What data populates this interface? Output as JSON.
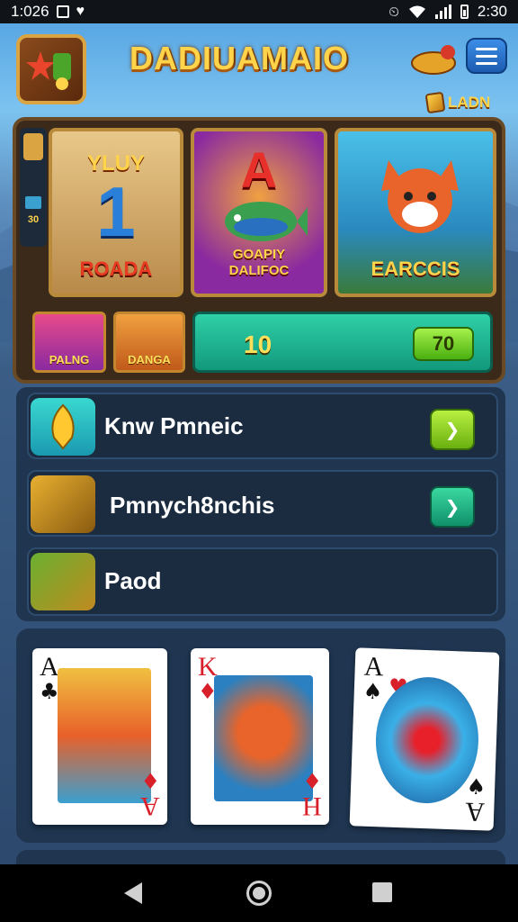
{
  "status_bar": {
    "time_left": "1:026",
    "time_right": "2:30"
  },
  "header": {
    "title": "DADIUAMAIO",
    "language_label": "LADN"
  },
  "side_strip": {
    "value": "30"
  },
  "slots": [
    {
      "top_text": "YLUY",
      "big_letter": "1",
      "bottom_text": "ROADA"
    },
    {
      "big_letter": "A",
      "bottom_text": "GOAPIY\nDALIFOC"
    },
    {
      "bottom_text": "EARCCIS"
    }
  ],
  "mini_games": [
    {
      "label": "PALNG"
    },
    {
      "label": "DANGA"
    }
  ],
  "bet": {
    "value": "10",
    "button_label": "70"
  },
  "menu_rows": [
    {
      "label": "Knw Pmneic"
    },
    {
      "label": "Pmnych8nchis"
    },
    {
      "label": "Paod"
    }
  ],
  "cards": [
    {
      "rank": "A",
      "suit": "♣",
      "corner_rank": "A",
      "corner_suit": "♦"
    },
    {
      "rank": "K",
      "suit": "♦",
      "suit2": "♥",
      "corner_rank": "H",
      "corner_suit": "♦"
    },
    {
      "rank": "A",
      "suit": "♠",
      "suit2": "♥",
      "corner_rank": "A",
      "corner_suit": "♠"
    }
  ],
  "colors": {
    "gold": "#ffd34a",
    "teal": "#2fd0a8",
    "green": "#a6f04a",
    "panel": "#1f3550"
  },
  "icons": [
    "wifi-icon",
    "signal-icon",
    "battery-icon",
    "menu-icon",
    "chevron-right-icon",
    "back-icon",
    "home-icon",
    "recents-icon"
  ]
}
